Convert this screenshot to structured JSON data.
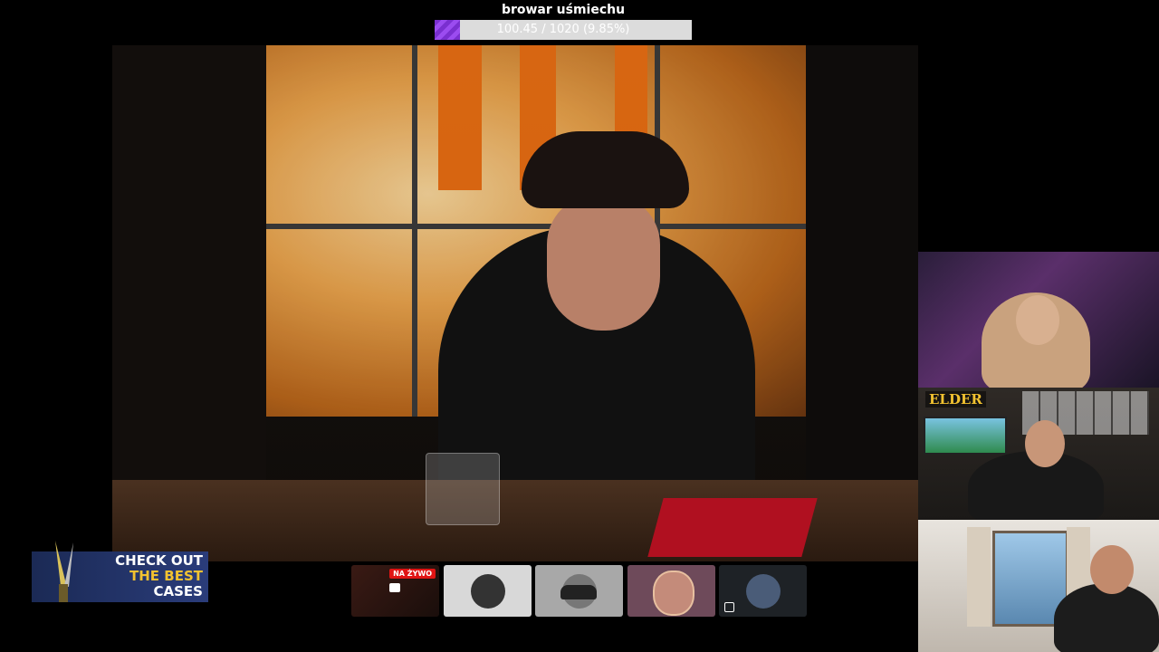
{
  "goal": {
    "title": "browar uśmiechu",
    "progress_text": "100.45 / 1020 (9.85%)",
    "progress_fraction": 0.0985,
    "fill_color": "#7a2fd0"
  },
  "main_video": {
    "subject": "person in black hoodie before stained glass window"
  },
  "webcams": {
    "cam2_logo": "ELDER"
  },
  "promo": {
    "line1": "CHECK OUT",
    "line2": "THE BEST",
    "line3": "CASES",
    "icon": "knife-icon"
  },
  "thumbnails": {
    "live_badge": "NA ŻYWO"
  }
}
